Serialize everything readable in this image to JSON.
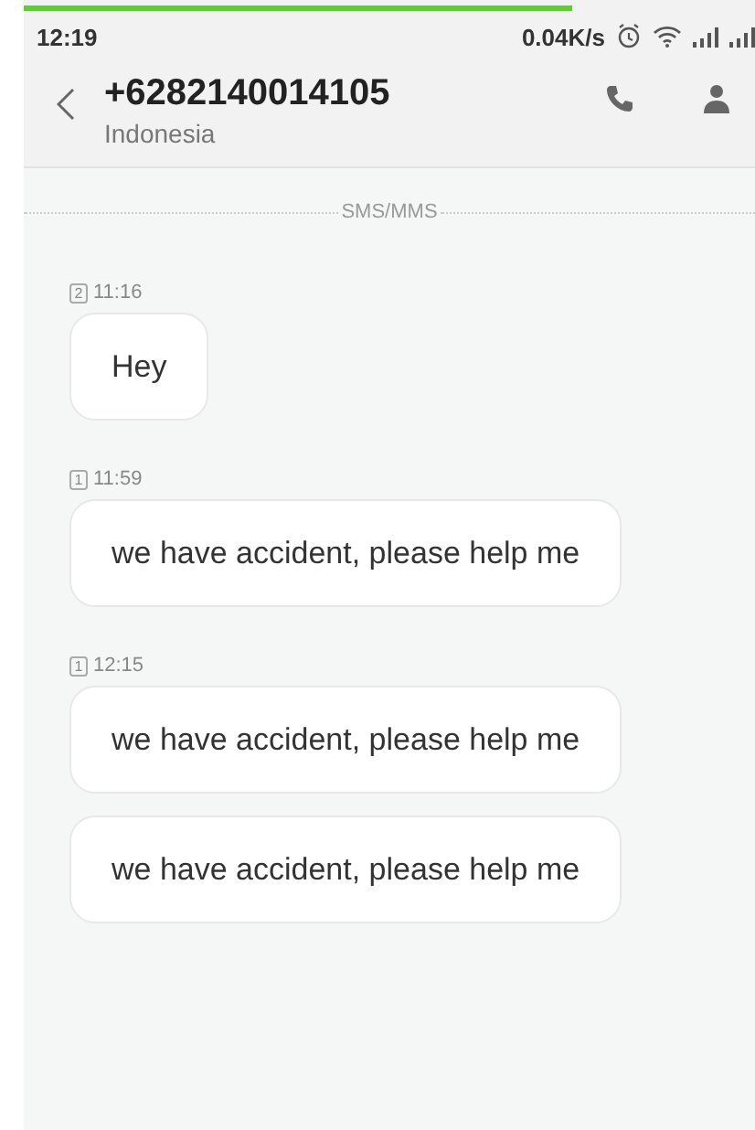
{
  "progress": {
    "level": 0.75
  },
  "status_bar": {
    "time": "12:19",
    "speed": "0.04K/s"
  },
  "header": {
    "title": "+6282140014105",
    "subtitle": "Indonesia"
  },
  "divider": "SMS/MMS",
  "groups": [
    {
      "sim": "2",
      "time": "11:16",
      "messages": [
        "Hey"
      ]
    },
    {
      "sim": "1",
      "time": "11:59",
      "messages": [
        "we have accident, please help me"
      ]
    },
    {
      "sim": "1",
      "time": "12:15",
      "messages": [
        "we have accident, please help me",
        "we have accident, please help me"
      ]
    }
  ]
}
